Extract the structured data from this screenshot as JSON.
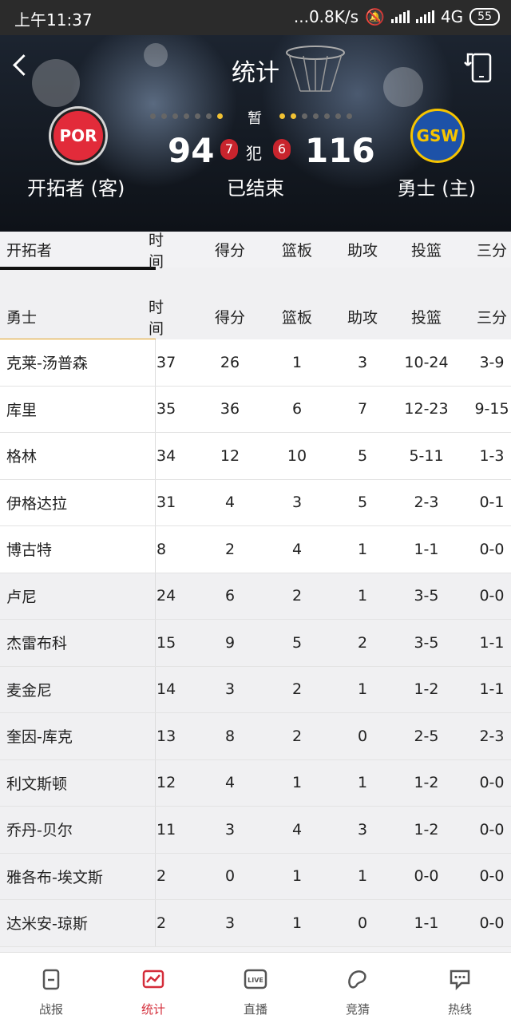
{
  "status_bar": {
    "time": "上午11:37",
    "network_speed": "...0.8K/s",
    "network_type": "4G",
    "battery": "55"
  },
  "header": {
    "title": "统计",
    "timeout_label": "暂",
    "foul_label": "犯",
    "status": "已结束",
    "away": {
      "name": "开拓者 (客)",
      "logo_text": "POR",
      "score": "94",
      "fouls": "7"
    },
    "home": {
      "name": "勇士 (主)",
      "logo_text": "GSW",
      "score": "116",
      "fouls": "6"
    }
  },
  "table": {
    "columns": [
      "时间",
      "得分",
      "篮板",
      "助攻",
      "投篮",
      "三分"
    ],
    "away_tab": "开拓者",
    "home_tab": "勇士",
    "home_players": [
      {
        "name": "克莱-汤普森",
        "min": "37",
        "pts": "26",
        "reb": "1",
        "ast": "3",
        "fg": "10-24",
        "tp": "3-9"
      },
      {
        "name": "库里",
        "min": "35",
        "pts": "36",
        "reb": "6",
        "ast": "7",
        "fg": "12-23",
        "tp": "9-15"
      },
      {
        "name": "格林",
        "min": "34",
        "pts": "12",
        "reb": "10",
        "ast": "5",
        "fg": "5-11",
        "tp": "1-3"
      },
      {
        "name": "伊格达拉",
        "min": "31",
        "pts": "4",
        "reb": "3",
        "ast": "5",
        "fg": "2-3",
        "tp": "0-1"
      },
      {
        "name": "博古特",
        "min": "8",
        "pts": "2",
        "reb": "4",
        "ast": "1",
        "fg": "1-1",
        "tp": "0-0"
      },
      {
        "name": "卢尼",
        "min": "24",
        "pts": "6",
        "reb": "2",
        "ast": "1",
        "fg": "3-5",
        "tp": "0-0"
      },
      {
        "name": "杰雷布科",
        "min": "15",
        "pts": "9",
        "reb": "5",
        "ast": "2",
        "fg": "3-5",
        "tp": "1-1"
      },
      {
        "name": "麦金尼",
        "min": "14",
        "pts": "3",
        "reb": "2",
        "ast": "1",
        "fg": "1-2",
        "tp": "1-1"
      },
      {
        "name": "奎因-库克",
        "min": "13",
        "pts": "8",
        "reb": "2",
        "ast": "0",
        "fg": "2-5",
        "tp": "2-3"
      },
      {
        "name": "利文斯顿",
        "min": "12",
        "pts": "4",
        "reb": "1",
        "ast": "1",
        "fg": "1-2",
        "tp": "0-0"
      },
      {
        "name": "乔丹-贝尔",
        "min": "11",
        "pts": "3",
        "reb": "4",
        "ast": "3",
        "fg": "1-2",
        "tp": "0-0"
      },
      {
        "name": "雅各布-埃文斯",
        "min": "2",
        "pts": "0",
        "reb": "1",
        "ast": "1",
        "fg": "0-0",
        "tp": "0-0"
      },
      {
        "name": "达米安-琼斯",
        "min": "2",
        "pts": "3",
        "reb": "1",
        "ast": "0",
        "fg": "1-1",
        "tp": "0-0"
      }
    ]
  },
  "tabbar": [
    {
      "label": "战报",
      "icon": "report-icon"
    },
    {
      "label": "统计",
      "icon": "stats-icon",
      "active": true
    },
    {
      "label": "直播",
      "icon": "live-icon"
    },
    {
      "label": "竞猜",
      "icon": "guess-icon"
    },
    {
      "label": "热线",
      "icon": "chat-icon"
    }
  ],
  "colors": {
    "accent": "#d42d3a",
    "away_underline": "#111111",
    "home_underline": "#e0a020"
  }
}
